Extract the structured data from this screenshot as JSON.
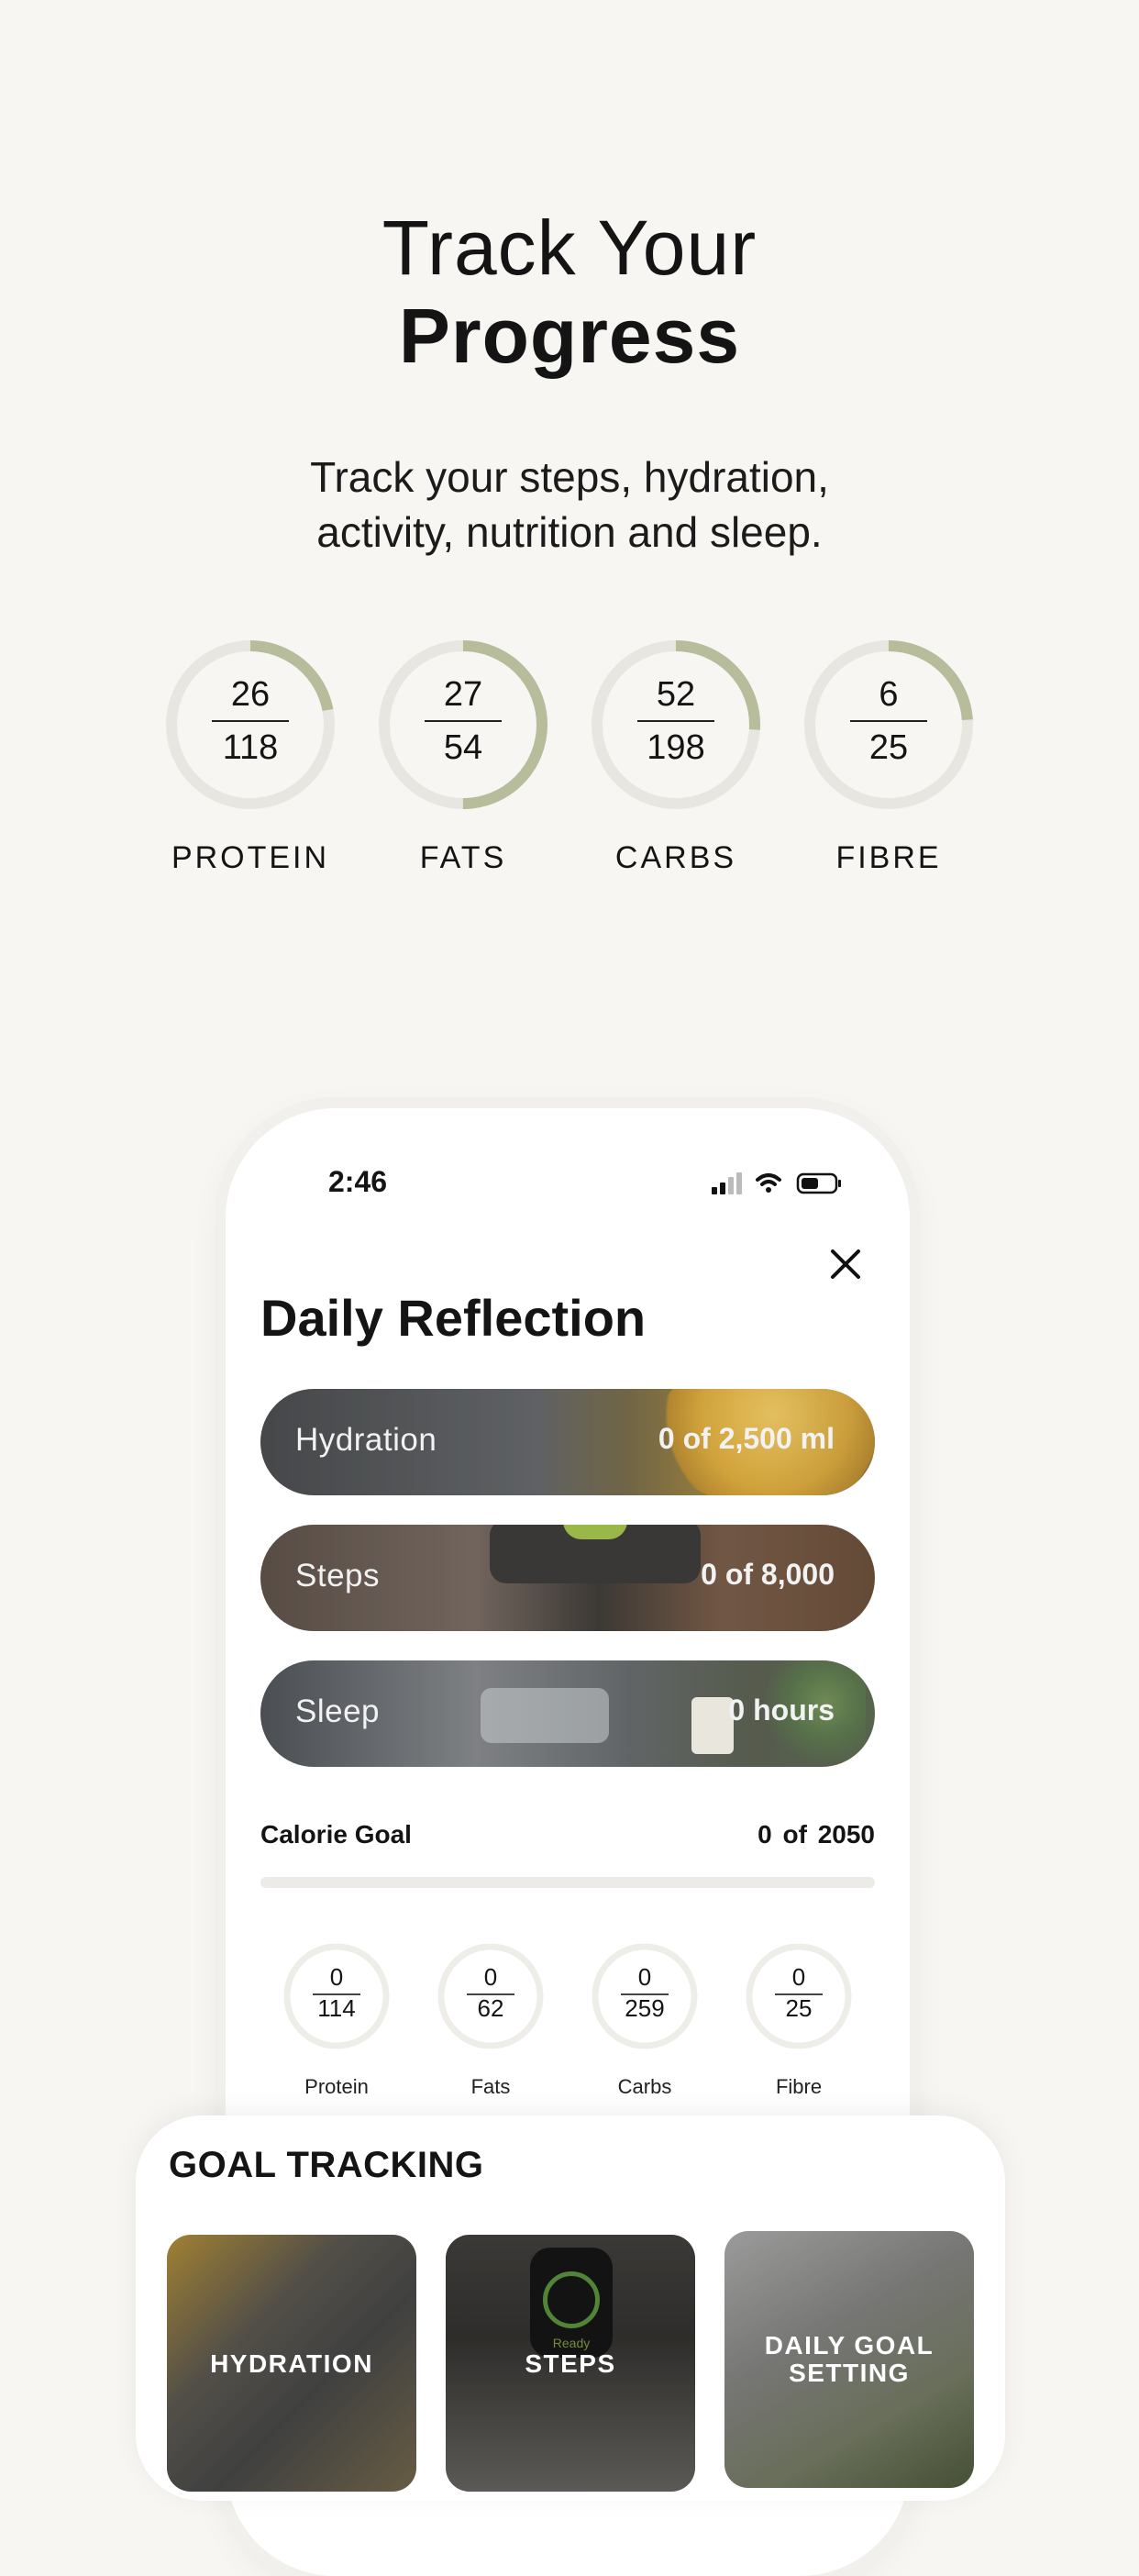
{
  "hero": {
    "title_line1": "Track Your",
    "title_line2": "Progress",
    "subtitle_line1": "Track your steps, hydration,",
    "subtitle_line2": "activity, nutrition and sleep."
  },
  "macros": [
    {
      "label": "PROTEIN",
      "value": "26",
      "goal": "118",
      "progress": 0.22
    },
    {
      "label": "FATS",
      "value": "27",
      "goal": "54",
      "progress": 0.5
    },
    {
      "label": "CARBS",
      "value": "52",
      "goal": "198",
      "progress": 0.26
    },
    {
      "label": "FIBRE",
      "value": "6",
      "goal": "25",
      "progress": 0.24
    }
  ],
  "phone": {
    "status_time": "2:46",
    "title": "Daily Reflection",
    "pills": {
      "hydration": {
        "label": "Hydration",
        "value": "0 of 2,500 ml"
      },
      "steps": {
        "label": "Steps",
        "value": "0 of 8,000"
      },
      "sleep": {
        "label": "Sleep",
        "value": "0 hours"
      }
    },
    "calorie": {
      "label": "Calorie Goal",
      "value": "0 of 2050",
      "progress": 0
    },
    "mini_macros": [
      {
        "label": "Protein",
        "value": "0",
        "goal": "114"
      },
      {
        "label": "Fats",
        "value": "0",
        "goal": "62"
      },
      {
        "label": "Carbs",
        "value": "0",
        "goal": "259"
      },
      {
        "label": "Fibre",
        "value": "0",
        "goal": "25"
      }
    ]
  },
  "goal_tracking": {
    "title": "GOAL TRACKING",
    "tiles": {
      "hydration": "HYDRATION",
      "steps": "STEPS",
      "goal_line1": "DAILY GOAL",
      "goal_line2": "SETTING"
    },
    "watch_text": "Ready"
  },
  "colors": {
    "background": "#f8f6f2",
    "ring_track": "#e7e6e0",
    "ring_progress": "#b7bc9a"
  }
}
